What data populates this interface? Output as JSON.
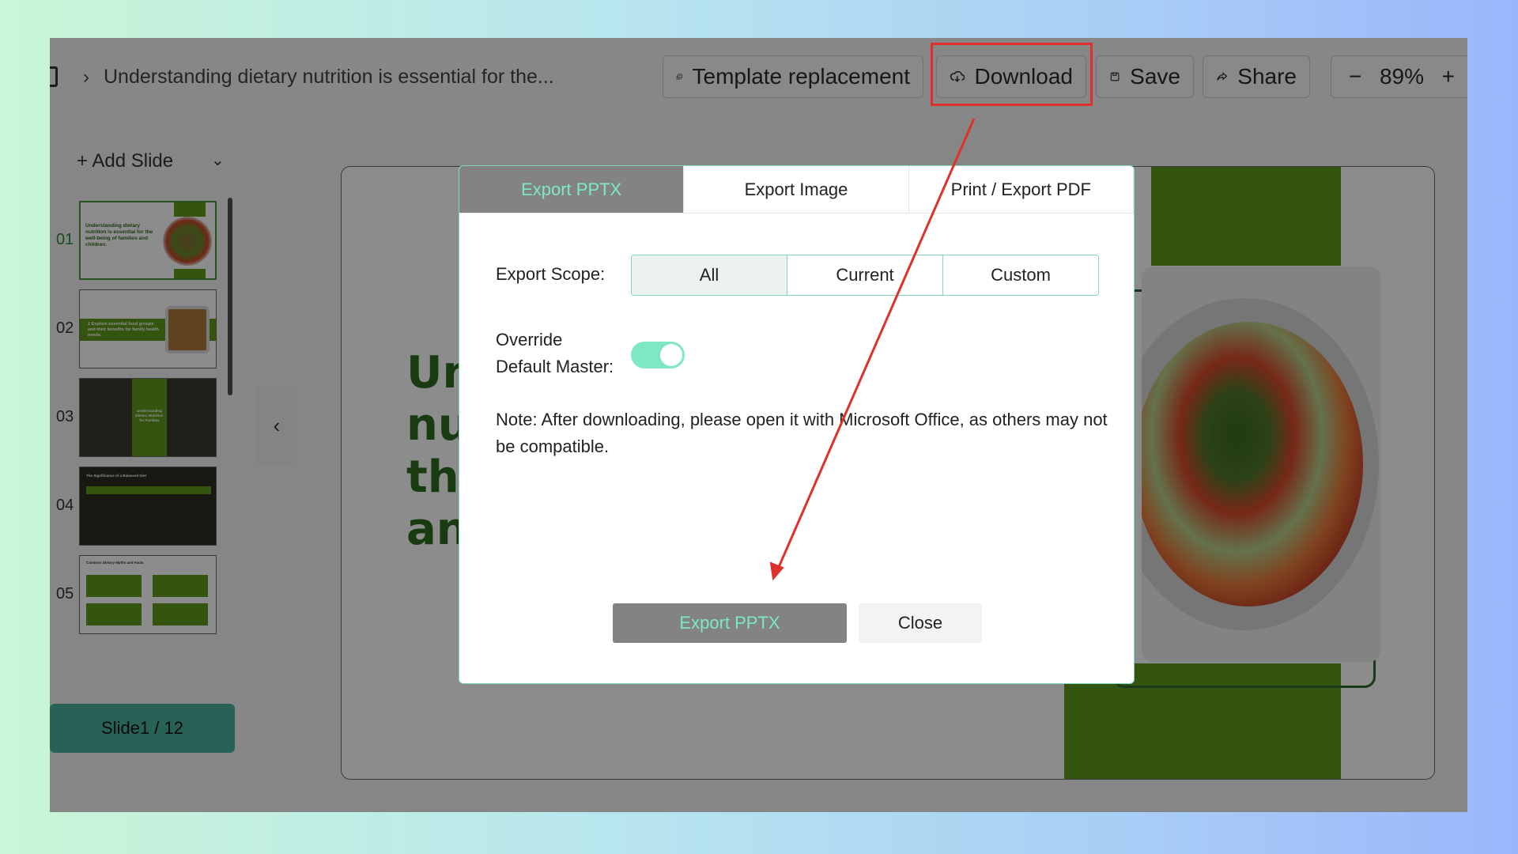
{
  "header": {
    "doc_title": "Understanding dietary nutrition is essential for the...",
    "template_replacement": "Template replacement",
    "download": "Download",
    "save": "Save",
    "share": "Share",
    "zoom_minus": "−",
    "zoom_value": "89%",
    "zoom_plus": "+"
  },
  "sidebar": {
    "add_slide": "+ Add Slide",
    "slides": [
      {
        "num": "01",
        "text": "Understanding dietary nutrition is essential for the well-being of families and children."
      },
      {
        "num": "02",
        "text": "1 Explore essential food groups and their benefits for family health needs."
      },
      {
        "num": "03",
        "text": "Understanding Dietary Nutrition for Families"
      },
      {
        "num": "04",
        "text": "The Significance of a Balanced Diet"
      },
      {
        "num": "05",
        "text": "Common Dietary Myths and Facts"
      }
    ],
    "counter": "Slide1 / 12",
    "collapse_icon": "chevron-left-icon"
  },
  "slide": {
    "title_lines": [
      "Un",
      "nu",
      "the",
      "an"
    ]
  },
  "modal": {
    "tabs": [
      "Export PPTX",
      "Export Image",
      "Print / Export PDF"
    ],
    "scope_label": "Export Scope:",
    "scope_options": [
      "All",
      "Current",
      "Custom"
    ],
    "override_label_1": "Override",
    "override_label_2": "Default Master:",
    "override_on": true,
    "note": "Note: After downloading, please open it with Microsoft Office, as others may not be compatible.",
    "primary_button": "Export PPTX",
    "close_button": "Close"
  },
  "colors": {
    "accent": "#7ee8c6",
    "highlight_red": "#e0302b",
    "slide_green": "#5f9a1e"
  }
}
